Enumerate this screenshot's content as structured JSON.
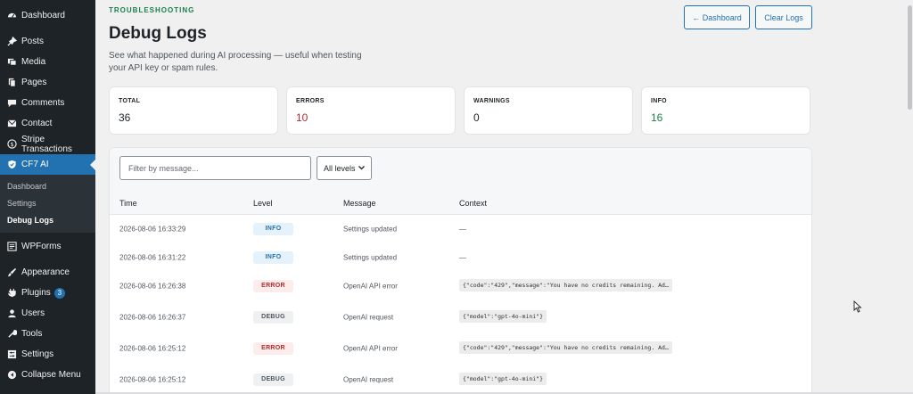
{
  "sidebar": {
    "items": [
      {
        "label": "Dashboard",
        "icon": "dashboard-icon"
      },
      {
        "label": "Posts",
        "icon": "pin-icon"
      },
      {
        "label": "Media",
        "icon": "media-icon"
      },
      {
        "label": "Pages",
        "icon": "pages-icon"
      },
      {
        "label": "Comments",
        "icon": "comment-icon"
      },
      {
        "label": "Contact",
        "icon": "mail-icon"
      },
      {
        "label": "Stripe Transactions",
        "icon": "dollar-icon"
      },
      {
        "label": "CF7 AI",
        "icon": "shield-icon"
      }
    ],
    "submenu": [
      "Dashboard",
      "Settings",
      "Debug Logs"
    ],
    "items2": [
      {
        "label": "WPForms",
        "icon": "forms-icon"
      },
      {
        "label": "Appearance",
        "icon": "brush-icon"
      },
      {
        "label": "Plugins",
        "icon": "plugin-icon",
        "badge": "3"
      },
      {
        "label": "Users",
        "icon": "user-icon"
      },
      {
        "label": "Tools",
        "icon": "wrench-icon"
      },
      {
        "label": "Settings",
        "icon": "settings-icon"
      },
      {
        "label": "Collapse Menu",
        "icon": "collapse-icon"
      }
    ]
  },
  "header": {
    "eyebrow": "TROUBLESHOOTING",
    "title": "Debug Logs",
    "description": "See what happened during AI processing — useful when testing your API key or spam rules.",
    "back_button": "← Dashboard",
    "clear_button": "Clear Logs"
  },
  "stats": [
    {
      "label": "TOTAL",
      "value": "36"
    },
    {
      "label": "ERRORS",
      "value": "10"
    },
    {
      "label": "WARNINGS",
      "value": "0"
    },
    {
      "label": "INFO",
      "value": "16"
    }
  ],
  "filter": {
    "placeholder": "Filter by message...",
    "level_select": "All levels"
  },
  "table": {
    "columns": [
      "Time",
      "Level",
      "Message",
      "Context"
    ],
    "rows": [
      {
        "time": "2026-08-06 16:33:29",
        "level": "INFO",
        "message": "Settings updated",
        "context": "—"
      },
      {
        "time": "2026-08-06 16:31:22",
        "level": "INFO",
        "message": "Settings updated",
        "context": "—"
      },
      {
        "time": "2026-08-06 16:26:38",
        "level": "ERROR",
        "message": "OpenAI API error",
        "context": "{\"code\":\"429\",\"message\":\"You have no credits remaining. Ad…"
      },
      {
        "time": "2026-08-06 16:26:37",
        "level": "DEBUG",
        "message": "OpenAI request",
        "context": "{\"model\":\"gpt-4o-mini\"}"
      },
      {
        "time": "2026-08-06 16:25:12",
        "level": "ERROR",
        "message": "OpenAI API error",
        "context": "{\"code\":\"429\",\"message\":\"You have no credits remaining. Ad…"
      },
      {
        "time": "2026-08-06 16:25:12",
        "level": "DEBUG",
        "message": "OpenAI request",
        "context": "{\"model\":\"gpt-4o-mini\"}"
      }
    ]
  }
}
